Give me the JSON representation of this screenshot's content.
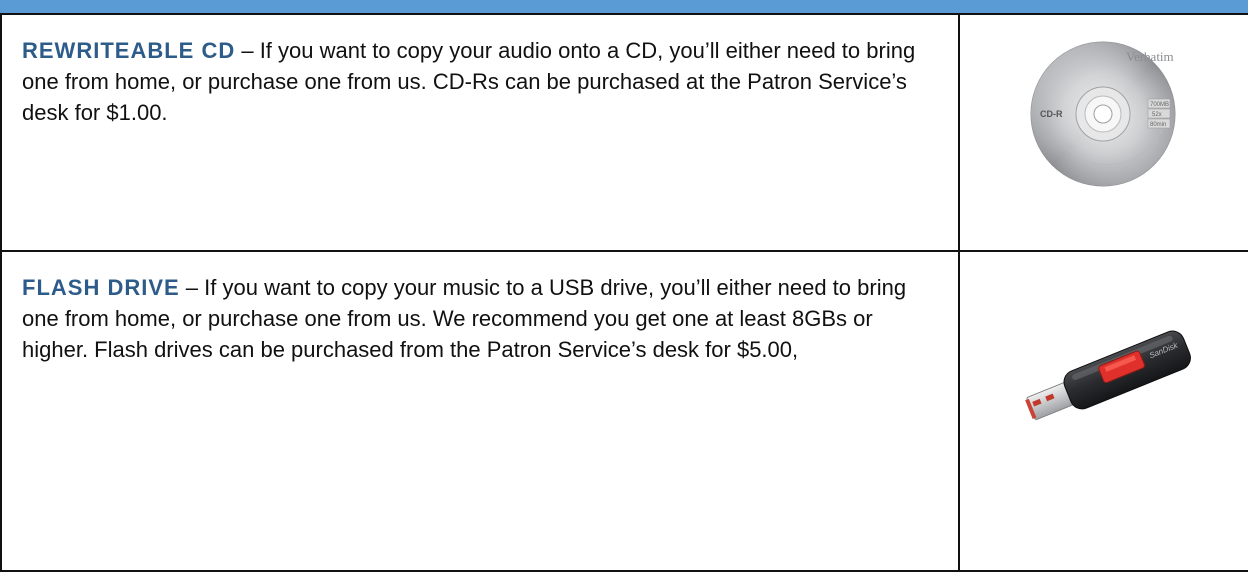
{
  "rows": [
    {
      "term": "REWRITEABLE CD",
      "separator": " – ",
      "description": "If you want to copy your audio onto a CD, you’ll either need to bring one from home, or purchase one from us. CD-Rs can be purchased at the Patron Service’s desk for $1.00.",
      "image": {
        "icon": "cd-icon",
        "brand": "Verbatim",
        "disc_label": "CD-R",
        "specs": [
          "700MB",
          "52x",
          "80min"
        ]
      }
    },
    {
      "term": "FLASH DRIVE",
      "separator": " – ",
      "description": "If you want to copy your music to a USB drive, you’ll either need to bring one from home, or purchase one from us. We recommend you get one at least 8GBs or higher. Flash drives can be purchased from the Patron Service’s desk for $5.00,",
      "image": {
        "icon": "usb-flash-drive-icon",
        "brand": "SanDisk"
      }
    }
  ],
  "colors": {
    "header_band": "#5b9bd5",
    "term": "#2e5c8a",
    "border": "#111111"
  }
}
